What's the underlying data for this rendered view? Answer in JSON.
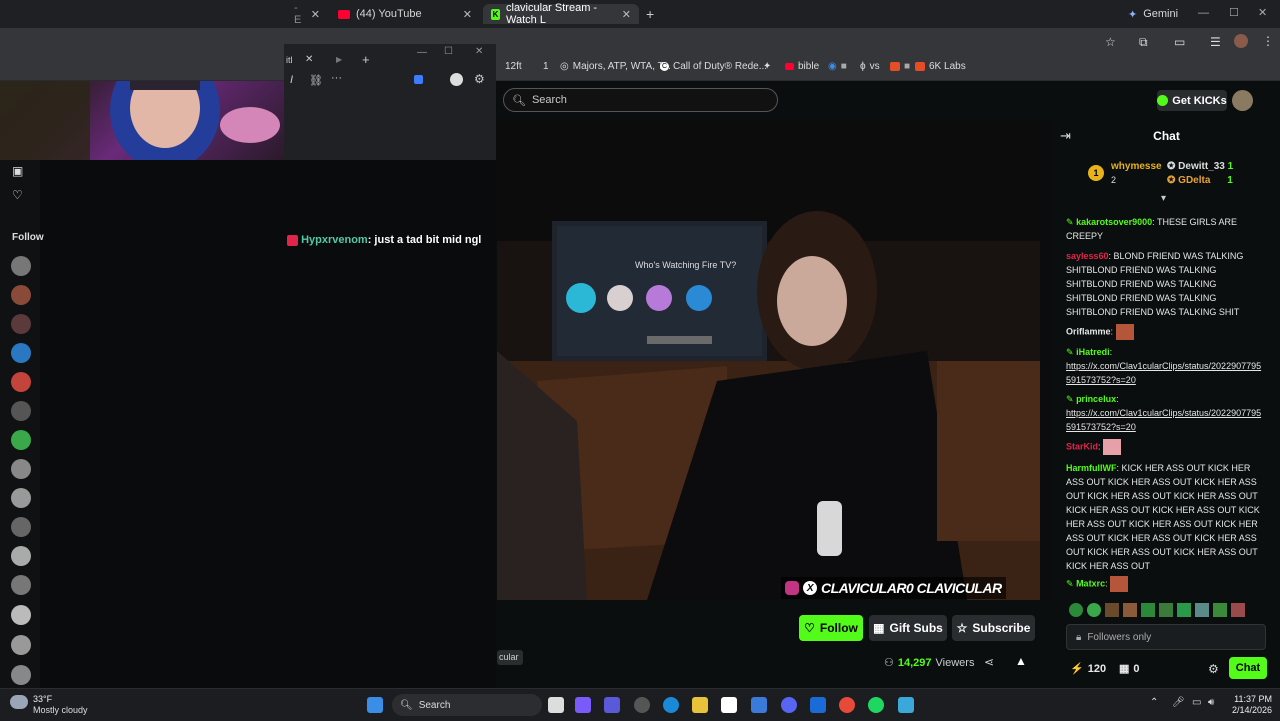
{
  "browser": {
    "tabs": [
      {
        "label": "(44) YouTube"
      },
      {
        "label": "clavicular Stream - Watch L"
      },
      {
        "label": "Gemini"
      }
    ],
    "bookmarks": [
      "12ft",
      "Majors, ATP, WTA, T...",
      "Call of Duty® Rede...",
      "bible",
      "vs",
      "6K Labs"
    ]
  },
  "kick": {
    "search_placeholder": "Search",
    "get_kicks": "Get KICKs",
    "chat_title": "Chat",
    "leaderboard": [
      {
        "name": "whymesse",
        "count": "2"
      },
      {
        "name": "Dewitt_33",
        "count": "1"
      },
      {
        "name": "GDelta",
        "count": "1"
      }
    ],
    "overlay_message": {
      "user": "Hypxrvenom",
      "text": ": just a tad bit mid ngl"
    },
    "video": {
      "tv_prompt": "Who's Watching Fire TV?",
      "watermark": "CLAVICULAR0  CLAVICULAR"
    },
    "chat_messages": [
      {
        "user": "kakarotsover9000",
        "text": ": THESE GIRLS ARE CREEPY",
        "color": "#53fc18"
      },
      {
        "user": "sayless60",
        "text": ": BLOND FRIEND WAS TALKING SHITBLOND FRIEND WAS TALKING SHITBLOND FRIEND WAS TALKING SHITBLOND FRIEND WAS TALKING SHITBLOND FRIEND WAS TALKING SHIT",
        "color": "#e0254a"
      },
      {
        "user": "Oriflamme",
        "text": ":",
        "color": "#e6e6e6"
      },
      {
        "user": "iHatredi",
        "text": ":",
        "color": "#53fc18"
      },
      {
        "link": "https://x.com/Clav1cularClips/status/2022907795591573752?s=20"
      },
      {
        "user": "princelux",
        "text": ":",
        "color": "#53fc18"
      },
      {
        "link": "https://x.com/Clav1cularClips/status/2022907795591573752?s=20"
      },
      {
        "user": "StarKid",
        "text": ":",
        "color": "#e0254a"
      },
      {
        "user": "HarmfullWF",
        "text": ": KICK HER ASS OUT KICK HER ASS OUT KICK HER ASS OUT KICK HER ASS OUT KICK HER ASS OUT KICK HER ASS OUT KICK HER ASS OUT KICK HER ASS OUT KICK HER ASS OUT KICK HER ASS OUT KICK HER ASS OUT KICK HER ASS OUT KICK HER ASS OUT KICK HER ASS OUT KICK HER ASS OUT KICK HER ASS OUT",
        "color": "#53fc18"
      },
      {
        "user": "Matxrc",
        "text": ":",
        "color": "#53fc18"
      }
    ],
    "followers_only": "Followers only",
    "chat_button": "Chat",
    "kicks_count": "120",
    "gift_count": "0",
    "follow": "Follow",
    "gift_subs": "Gift Subs",
    "subscribe": "Subscribe",
    "viewers": "14,297",
    "viewers_label": "Viewers",
    "channel_snippet": "cular",
    "sidebar_following": "Follow"
  },
  "taskbar": {
    "weather_temp": "33°F",
    "weather_desc": "Mostly cloudy",
    "search": "Search",
    "time": "11:37 PM",
    "date": "2/14/2026"
  }
}
